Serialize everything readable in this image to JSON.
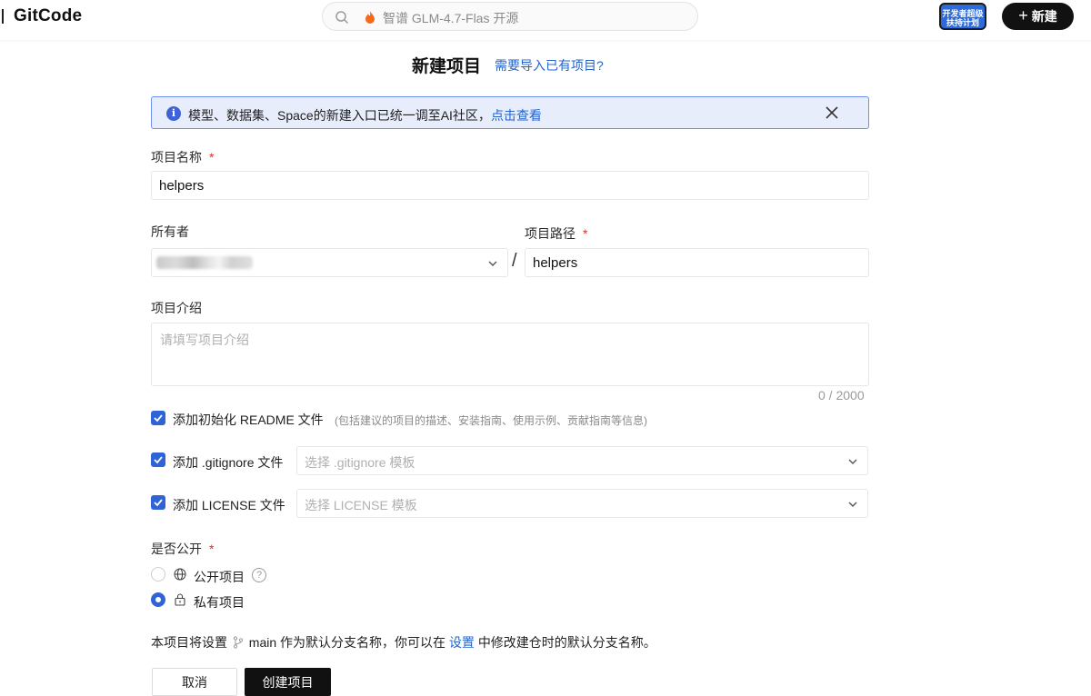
{
  "header": {
    "brand": "GitCode",
    "search_placeholder": "智谱 GLM-4.7-Flas 开源",
    "badge_text": "开发者超级 扶持计划",
    "new_button": "新建"
  },
  "page": {
    "title": "新建项目",
    "import_link": "需要导入已有项目?"
  },
  "banner": {
    "text": "模型、数据集、Space的新建入口已统一调至AI社区，",
    "link": "点击查看"
  },
  "form": {
    "name_label": "项目名称",
    "required_mark": "*",
    "name_value": "helpers",
    "owner_label": "所有者",
    "path_label": "项目路径",
    "path_separator": "/",
    "path_value": "helpers",
    "desc_label": "项目介绍",
    "desc_placeholder": "请填写项目介绍",
    "desc_counter": "0 / 2000",
    "readme_label": "添加初始化 README 文件",
    "readme_hint": "(包括建议的项目的描述、安装指南、使用示例、贡献指南等信息)",
    "gitignore_label": "添加 .gitignore 文件",
    "gitignore_placeholder": "选择 .gitignore 模板",
    "license_label": "添加 LICENSE 文件",
    "license_placeholder": "选择 LICENSE 模板",
    "visibility_label": "是否公开",
    "public_label": "公开项目",
    "private_label": "私有项目",
    "help_glyph": "?",
    "visibility_selected": "私有项目",
    "readme_checked": true,
    "gitignore_checked": true,
    "license_checked": true
  },
  "branch_note": {
    "prefix": "本项目将设置",
    "branch": "main",
    "middle": "作为默认分支名称，你可以在",
    "link": "设置",
    "suffix": "中修改建仓时的默认分支名称。"
  },
  "actions": {
    "cancel": "取消",
    "create": "创建项目"
  },
  "colors": {
    "accent": "#2f63d6",
    "link": "#2563c9",
    "required": "#d93025",
    "banner_bg": "#e8edfb"
  }
}
